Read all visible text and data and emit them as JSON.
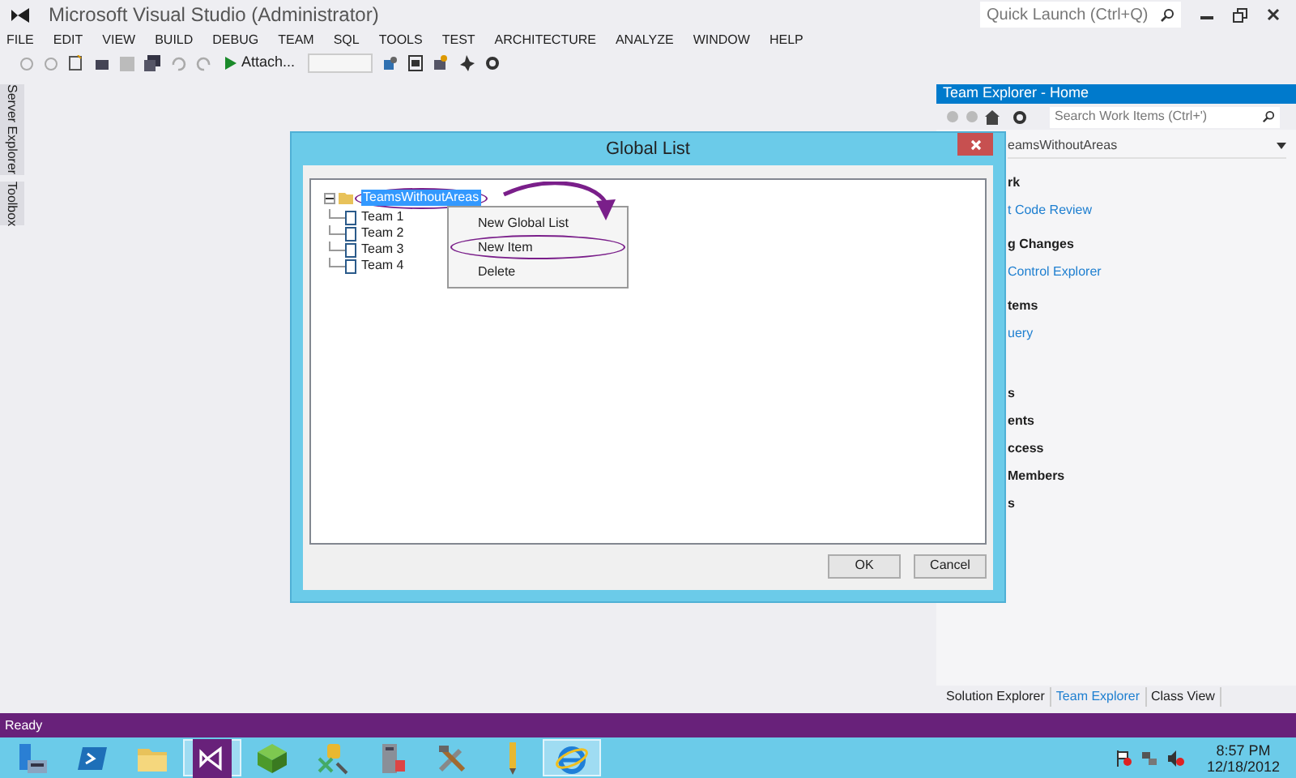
{
  "window": {
    "title": "Microsoft Visual Studio (Administrator)"
  },
  "quick_launch": {
    "placeholder": "Quick Launch (Ctrl+Q)"
  },
  "menu": [
    "FILE",
    "EDIT",
    "VIEW",
    "BUILD",
    "DEBUG",
    "TEAM",
    "SQL",
    "TOOLS",
    "TEST",
    "ARCHITECTURE",
    "ANALYZE",
    "WINDOW",
    "HELP"
  ],
  "toolbar": {
    "attach_button": "Attach..."
  },
  "side_tabs": [
    "Server Explorer",
    "Toolbox"
  ],
  "team_explorer": {
    "title": "Team Explorer - Home",
    "search": {
      "placeholder": "Search Work Items (Ctrl+')"
    },
    "project": "eamsWithoutAreas",
    "items": [
      {
        "kind": "heading",
        "text": "rk"
      },
      {
        "kind": "link",
        "text": "t Code Review"
      },
      {
        "kind": "heading",
        "text": "g Changes"
      },
      {
        "kind": "link",
        "text": "Control Explorer"
      },
      {
        "kind": "heading",
        "text": "tems"
      },
      {
        "kind": "link",
        "text": "uery"
      },
      {
        "kind": "heading",
        "text": "s"
      },
      {
        "kind": "heading",
        "text": "ents"
      },
      {
        "kind": "heading",
        "text": "ccess"
      },
      {
        "kind": "heading",
        "text": "Members"
      },
      {
        "kind": "heading",
        "text": "s"
      }
    ]
  },
  "bottom_tabs": [
    {
      "label": "Solution Explorer",
      "selected": false
    },
    {
      "label": "Team Explorer",
      "selected": true
    },
    {
      "label": "Class View",
      "selected": false
    }
  ],
  "dialog": {
    "title": "Global List",
    "tree": {
      "label": "TeamsWithoutAreas",
      "expanded": true,
      "selected": true,
      "circled": true,
      "children": [
        {
          "label": "Team 1"
        },
        {
          "label": "Team 2"
        },
        {
          "label": "Team 3"
        },
        {
          "label": "Team 4"
        }
      ]
    },
    "context_menu": [
      {
        "label": "New Global List",
        "circled": false
      },
      {
        "label": "New Item",
        "circled": true
      },
      {
        "label": "Delete",
        "circled": false
      }
    ],
    "buttons": [
      "OK",
      "Cancel"
    ]
  },
  "status_bar": "Ready",
  "taskbar": {
    "apps": [
      {
        "kind": "server",
        "active": false
      },
      {
        "kind": "powershell",
        "active": false
      },
      {
        "kind": "folder",
        "active": false
      },
      {
        "kind": "visualstudio",
        "active": true
      },
      {
        "kind": "package",
        "active": false
      },
      {
        "kind": "tools-db",
        "active": false
      },
      {
        "kind": "tower",
        "active": false
      },
      {
        "kind": "tools",
        "active": false
      },
      {
        "kind": "pen",
        "active": false
      },
      {
        "kind": "browser",
        "active": true
      }
    ],
    "time": "8:57 PM",
    "date": "12/18/2012"
  }
}
